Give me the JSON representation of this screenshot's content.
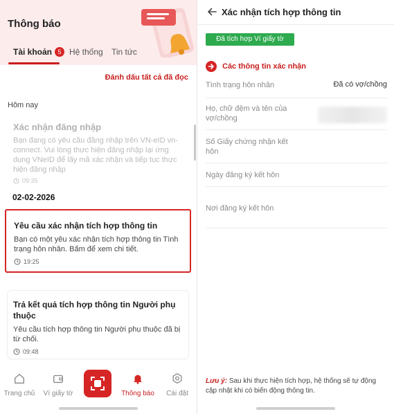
{
  "left": {
    "header": {
      "title": "Thông báo"
    },
    "tabs": [
      {
        "label": "Tài khoản",
        "badge": "5",
        "active": true
      },
      {
        "label": "Hệ thống",
        "active": false
      },
      {
        "label": "Tin tức",
        "active": false
      }
    ],
    "mark_all_read": "Đánh dấu tất cả đã đọc",
    "section_today": "Hôm nay",
    "notifications": [
      {
        "title": "Xác nhận đăng nhập",
        "body": "Bạn đang có yêu cầu đăng nhập trên VN-eID vn-connect. Vui lòng thực hiện đăng nhập lại ứng dụng VNeID để lấy mã xác nhận và tiếp tục thực hiện đăng nhập",
        "time": "09:35"
      },
      {
        "title": "Yêu cầu xác nhận tích hợp thông tin",
        "body": "Bạn có một yêu xác nhận tích hợp thông tin Tình trạng hôn nhân. Bấm để xem chi tiết.",
        "time": "19:25"
      },
      {
        "title": "Trả kết quả tích hợp thông tin Người phụ thuộc",
        "body": "Yêu cầu tích hợp thông tin Người phụ thuộc đã bị từ chối.",
        "time": "09:48"
      }
    ],
    "date_label": "02-02-2026",
    "bottom_nav": [
      {
        "label": "Trang chủ",
        "icon": "home-icon"
      },
      {
        "label": "Ví giấy tờ",
        "icon": "wallet-icon"
      },
      {
        "label": "",
        "icon": "scan-icon"
      },
      {
        "label": "Thông báo",
        "icon": "bell-icon"
      },
      {
        "label": "Cài đặt",
        "icon": "gear-icon"
      }
    ],
    "colors": {
      "accent": "#d62525",
      "header_bg": "#fdecec"
    }
  },
  "right": {
    "header": {
      "title": "Xác nhận tích hợp thông tin"
    },
    "status_pill": "Đã tích hợp Ví giấy tờ",
    "section_title": "Các thông tin xác nhận",
    "rows": [
      {
        "label": "Tình trạng hôn nhân",
        "value": "Đã có vợ/chồng"
      },
      {
        "label": "Họ, chữ đệm và tên của vợ/chồng",
        "value": ""
      },
      {
        "label": "Số Giấy chứng nhận kết hôn",
        "value": ""
      },
      {
        "label": "Ngày đăng ký kết hôn",
        "value": ""
      },
      {
        "label": "Nơi đăng ký kết hôn",
        "value": ""
      }
    ],
    "note_key": "Lưu ý:",
    "note_text": "Sau khi thực hiện tích hợp, hệ thống sẽ tự động cập nhật khi có biến động thông tin.",
    "colors": {
      "pill": "#2eaa4f"
    }
  }
}
